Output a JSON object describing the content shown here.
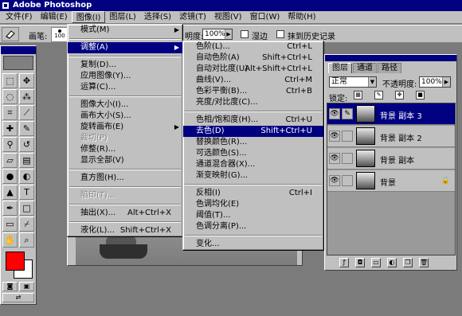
{
  "titlebar": {
    "title": "Adobe Photoshop"
  },
  "menubar": [
    "文件(F)",
    "编辑(E)",
    "图像(I)",
    "图层(L)",
    "选择(S)",
    "滤镜(T)",
    "视图(V)",
    "窗口(W)",
    "帮助(H)"
  ],
  "options": {
    "brush_label": "画笔:",
    "brush_size": "100",
    "opacity_label": "明度:",
    "opacity_value": "100%",
    "wet_edges": "湿边",
    "erase_history": "抹到历史记录"
  },
  "image_menu": [
    {
      "label": "模式(M)",
      "sub": true
    },
    {
      "sep": true
    },
    {
      "label": "调整(A)",
      "sub": true,
      "highlighted": true
    },
    {
      "sep": true
    },
    {
      "label": "复制(D)..."
    },
    {
      "label": "应用图像(Y)..."
    },
    {
      "label": "运算(C)..."
    },
    {
      "sep": true
    },
    {
      "label": "图像大小(I)..."
    },
    {
      "label": "画布大小(S)..."
    },
    {
      "label": "旋转画布(E)",
      "sub": true
    },
    {
      "label": "裁切(P)",
      "disabled": true
    },
    {
      "label": "修整(R)..."
    },
    {
      "label": "显示全部(V)"
    },
    {
      "sep": true
    },
    {
      "label": "直方图(H)..."
    },
    {
      "sep": true
    },
    {
      "label": "陷印(T)...",
      "disabled": true
    },
    {
      "sep": true
    },
    {
      "label": "抽出(X)...",
      "shortcut": "Alt+Ctrl+X"
    },
    {
      "sep": true
    },
    {
      "label": "液化(L)...",
      "shortcut": "Shift+Ctrl+X"
    }
  ],
  "adjust_menu": [
    {
      "label": "色阶(L)...",
      "shortcut": "Ctrl+L"
    },
    {
      "label": "自动色阶(A)",
      "shortcut": "Shift+Ctrl+L"
    },
    {
      "label": "自动对比度(U)",
      "shortcut": "Alt+Shift+Ctrl+L"
    },
    {
      "label": "曲线(V)...",
      "shortcut": "Ctrl+M"
    },
    {
      "label": "色彩平衡(B)...",
      "shortcut": "Ctrl+B"
    },
    {
      "label": "亮度/对比度(C)..."
    },
    {
      "sep": true
    },
    {
      "label": "色相/饱和度(H)...",
      "shortcut": "Ctrl+U"
    },
    {
      "label": "去色(D)",
      "shortcut": "Shift+Ctrl+U",
      "highlighted": true
    },
    {
      "label": "替换颜色(R)..."
    },
    {
      "label": "可选颜色(S)..."
    },
    {
      "label": "通道混合器(X)..."
    },
    {
      "label": "渐变映射(G)..."
    },
    {
      "sep": true
    },
    {
      "label": "反相(I)",
      "shortcut": "Ctrl+I"
    },
    {
      "label": "色调均化(E)"
    },
    {
      "label": "阈值(T)..."
    },
    {
      "label": "色调分离(P)..."
    },
    {
      "sep": true
    },
    {
      "label": "变化..."
    }
  ],
  "layers_panel": {
    "tabs": [
      "图层",
      "通道",
      "路径"
    ],
    "blend_mode": "正常",
    "opacity_label": "不透明度:",
    "opacity_value": "100%",
    "lock_label": "锁定:",
    "layers": [
      {
        "name": "背景 副本 3",
        "selected": true
      },
      {
        "name": "背景 副本 2"
      },
      {
        "name": "背景 副本"
      },
      {
        "name": "背景",
        "locked": true
      }
    ]
  },
  "colors": {
    "foreground": "#ff0000",
    "background": "#ffffff",
    "title_bar": "#000080",
    "chrome": "#c0c0c0"
  }
}
